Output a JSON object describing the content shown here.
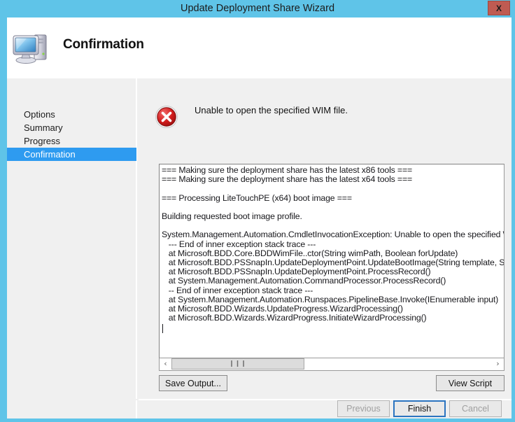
{
  "window": {
    "title": "Update Deployment Share Wizard",
    "close_label": "X",
    "accent_color": "#5fc4e8",
    "close_color": "#bf5b52"
  },
  "header": {
    "title": "Confirmation",
    "icon": "computer-icon"
  },
  "sidebar": {
    "items": [
      {
        "label": "Options",
        "selected": false
      },
      {
        "label": "Summary",
        "selected": false
      },
      {
        "label": "Progress",
        "selected": false
      },
      {
        "label": "Confirmation",
        "selected": true
      }
    ],
    "selected_color": "#2e9bf0"
  },
  "status": {
    "icon": "error-circle-x-icon",
    "icon_color": "#cc1616",
    "message": "Unable to open the specified WIM file."
  },
  "log": {
    "text": "=== Making sure the deployment share has the latest x86 tools ===\n=== Making sure the deployment share has the latest x64 tools ===\n\n=== Processing LiteTouchPE (x64) boot image ===\n\nBuilding requested boot image profile.\n\nSystem.Management.Automation.CmdletInvocationException: Unable to open the specified WIM file. --->\n   --- End of inner exception stack trace ---\n   at Microsoft.BDD.Core.BDDWimFile..ctor(String wimPath, Boolean forUpdate)\n   at Microsoft.BDD.PSSnapIn.UpdateDeploymentPoint.UpdateBootImage(String template, String platform\n   at Microsoft.BDD.PSSnapIn.UpdateDeploymentPoint.ProcessRecord()\n   at System.Management.Automation.CommandProcessor.ProcessRecord()\n   -- End of inner exception stack trace ---\n   at System.Management.Automation.Runspaces.PipelineBase.Invoke(IEnumerable input)\n   at Microsoft.BDD.Wizards.UpdateProgress.WizardProcessing()\n   at Microsoft.BDD.Wizards.WizardProgress.InitiateWizardProcessing()",
    "scrollbar": {
      "left_arrow": "‹",
      "right_arrow": "›",
      "grip": "❙❙❙"
    }
  },
  "actions": {
    "save_output": "Save Output...",
    "view_script": "View Script"
  },
  "navigation": {
    "previous": "Previous",
    "finish": "Finish",
    "cancel": "Cancel"
  }
}
